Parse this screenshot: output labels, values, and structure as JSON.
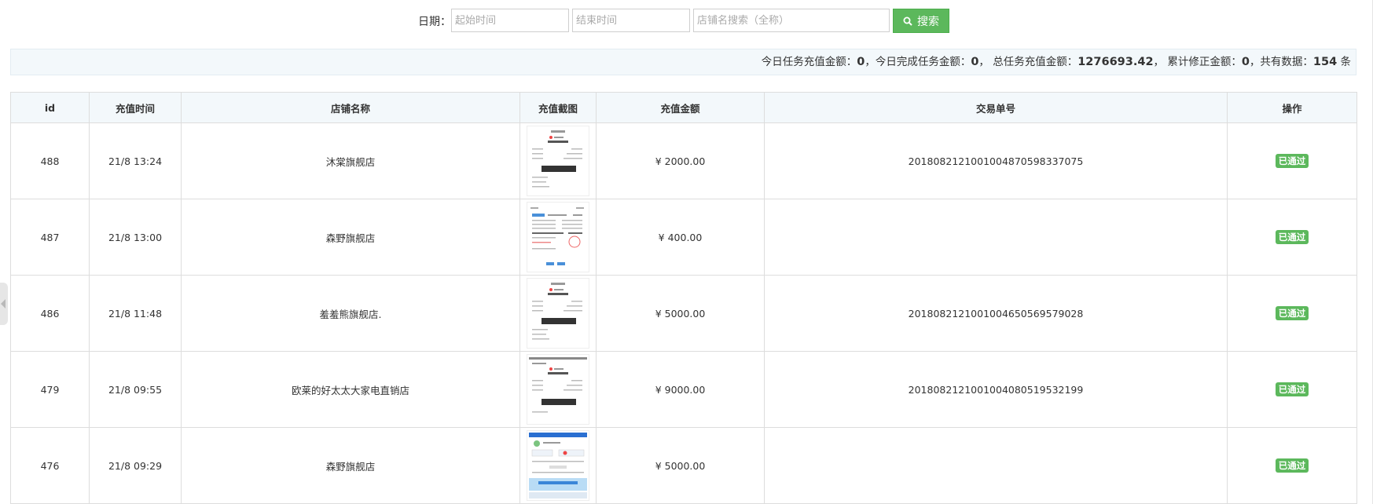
{
  "search": {
    "date_label": "日期：",
    "start_placeholder": "起始时间",
    "end_placeholder": "结束时间",
    "shop_placeholder": "店铺名搜索（全称）",
    "button_label": "搜索",
    "button_icon": "search-icon"
  },
  "stats": {
    "today_recharge_label": "今日任务充值金额：",
    "today_recharge_value": "0",
    "today_done_label": "，今日完成任务金额：",
    "today_done_value": "0",
    "total_label": "， 总任务充值金额：",
    "total_value": "1276693.42",
    "correction_label": "， 累计修正金额：",
    "correction_value": "0",
    "count_label": "，共有数据：",
    "count_value": "154",
    "count_unit": " 条"
  },
  "table": {
    "headers": [
      "id",
      "充值时间",
      "店铺名称",
      "充值截图",
      "充值金额",
      "交易单号",
      "操作"
    ],
    "rows": [
      {
        "id": "488",
        "time": "21/8 13:24",
        "shop": "沐棠旗舰店",
        "amount": "¥ 2000.00",
        "txn": "2018082121001004870598337075",
        "action": "已通过"
      },
      {
        "id": "487",
        "time": "21/8 13:00",
        "shop": "森野旗舰店",
        "amount": "¥ 400.00",
        "txn": "",
        "action": "已通过"
      },
      {
        "id": "486",
        "time": "21/8 11:48",
        "shop": "羞羞熊旗舰店.",
        "amount": "¥ 5000.00",
        "txn": "2018082121001004650569579028",
        "action": "已通过"
      },
      {
        "id": "479",
        "time": "21/8 09:55",
        "shop": "欧莱的好太太大家电直销店",
        "amount": "¥ 9000.00",
        "txn": "2018082121001004080519532199",
        "action": "已通过"
      },
      {
        "id": "476",
        "time": "21/8 09:29",
        "shop": "森野旗舰店",
        "amount": "¥ 5000.00",
        "txn": "",
        "action": "已通过"
      }
    ]
  },
  "colors": {
    "accent_green": "#5cb85c",
    "header_bg": "#f3f8fb"
  }
}
